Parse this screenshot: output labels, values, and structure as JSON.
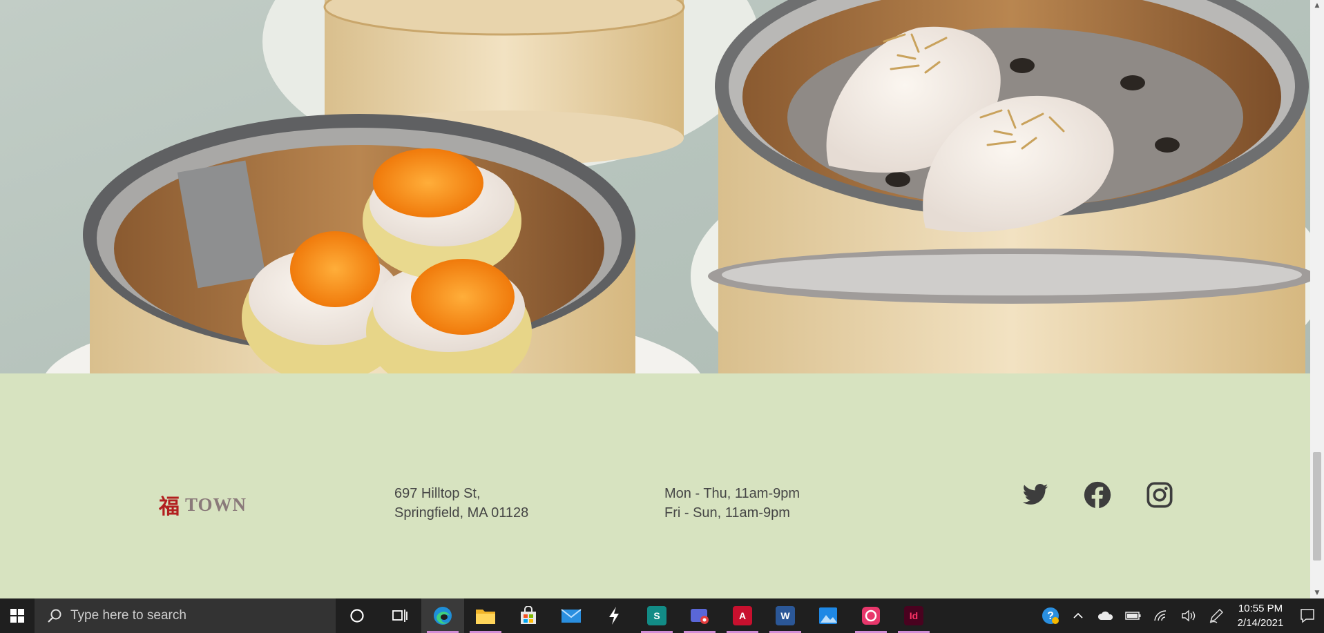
{
  "hero": {
    "image": "dim sum in bamboo steamers"
  },
  "footer": {
    "logo": {
      "char": "福",
      "word": "TOWN"
    },
    "address": {
      "line1": "697 Hilltop St,",
      "line2": "Springfield, MA 01128"
    },
    "hours": {
      "line1": "Mon - Thu, 11am-9pm",
      "line2": "Fri - Sun, 11am-9pm"
    },
    "social": [
      "twitter-icon",
      "facebook-icon",
      "instagram-icon"
    ]
  },
  "colors": {
    "footer_bg": "#d7e3c0",
    "footer_text": "#454545",
    "logo_red": "#b21f1f",
    "taskbar_bg": "#1f1f1f"
  },
  "scrollbar": {
    "position": 0.76
  },
  "taskbar": {
    "search_placeholder": "Type here to search",
    "apps": [
      "cortana-icon",
      "task-view-icon",
      "edge-icon",
      "file-explorer-icon",
      "store-icon",
      "mail-icon",
      "app-icon",
      "sway-icon",
      "snip-icon",
      "acrobat-icon",
      "word-icon",
      "photos-icon",
      "creative-cloud-icon",
      "indesign-icon"
    ],
    "clock": {
      "time": "10:55 PM",
      "date": "2/14/2021"
    }
  }
}
